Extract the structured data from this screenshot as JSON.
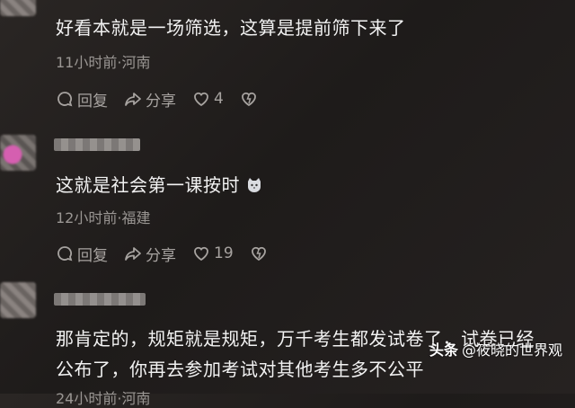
{
  "comments": [
    {
      "text": "好看本就是一场筛选，这算是提前筛下来了",
      "meta": "11小时前·河南",
      "reply_label": "回复",
      "share_label": "分享",
      "like_count": "4"
    },
    {
      "text": "这就是社会第一课按时",
      "meta": "12小时前·福建",
      "reply_label": "回复",
      "share_label": "分享",
      "like_count": "19"
    },
    {
      "text_line1": "那肯定的，规矩就是规矩，万千考生都发试卷了，试卷已经",
      "text_line2": "公布了，你再去参加考试对其他考生多不公平",
      "meta": "24小时前·河南"
    }
  ],
  "watermark": {
    "brand": "头条",
    "handle": "@筱晓的世界观"
  },
  "colors": {
    "background": "#221f1e",
    "text": "#f2f2f2",
    "meta": "#9a9693",
    "action": "#a7a3a0"
  },
  "icons": [
    "reply-icon",
    "share-icon",
    "like-icon",
    "dislike-icon",
    "cat-emoji-icon"
  ]
}
